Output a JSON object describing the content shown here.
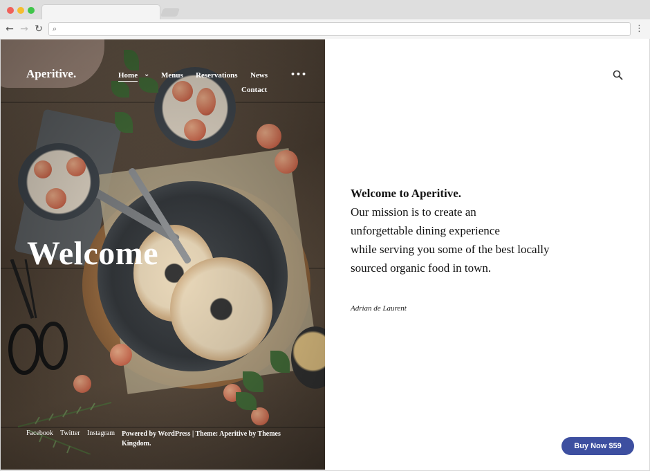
{
  "browser": {
    "back_icon": "←",
    "forward_icon": "→",
    "reload_icon": "↻",
    "search_icon": "⌕",
    "menu_icon": "⋮",
    "url": ""
  },
  "site": {
    "brand": "Aperitive.",
    "nav": {
      "home": "Home",
      "home_chevron": "⌄",
      "menus": "Menus",
      "reservations": "Reservations",
      "news": "News",
      "more": "•••",
      "contact": "Contact"
    },
    "hero_title": "Welcome",
    "footer": {
      "facebook": "Facebook",
      "twitter": "Twitter",
      "instagram": "Instagram",
      "credit": "Powered by WordPress | Theme: Aperitive by Themes Kingdom."
    }
  },
  "content": {
    "title": "Welcome to Aperitive.",
    "lines": [
      "Our mission is to create an",
      "unforgettable dining experience",
      "while serving you some of the best locally",
      "sourced organic food in town."
    ],
    "signature": "Adrian de Laurent"
  },
  "cta": {
    "label": "Buy Now $59",
    "color": "#3d4fa0"
  }
}
